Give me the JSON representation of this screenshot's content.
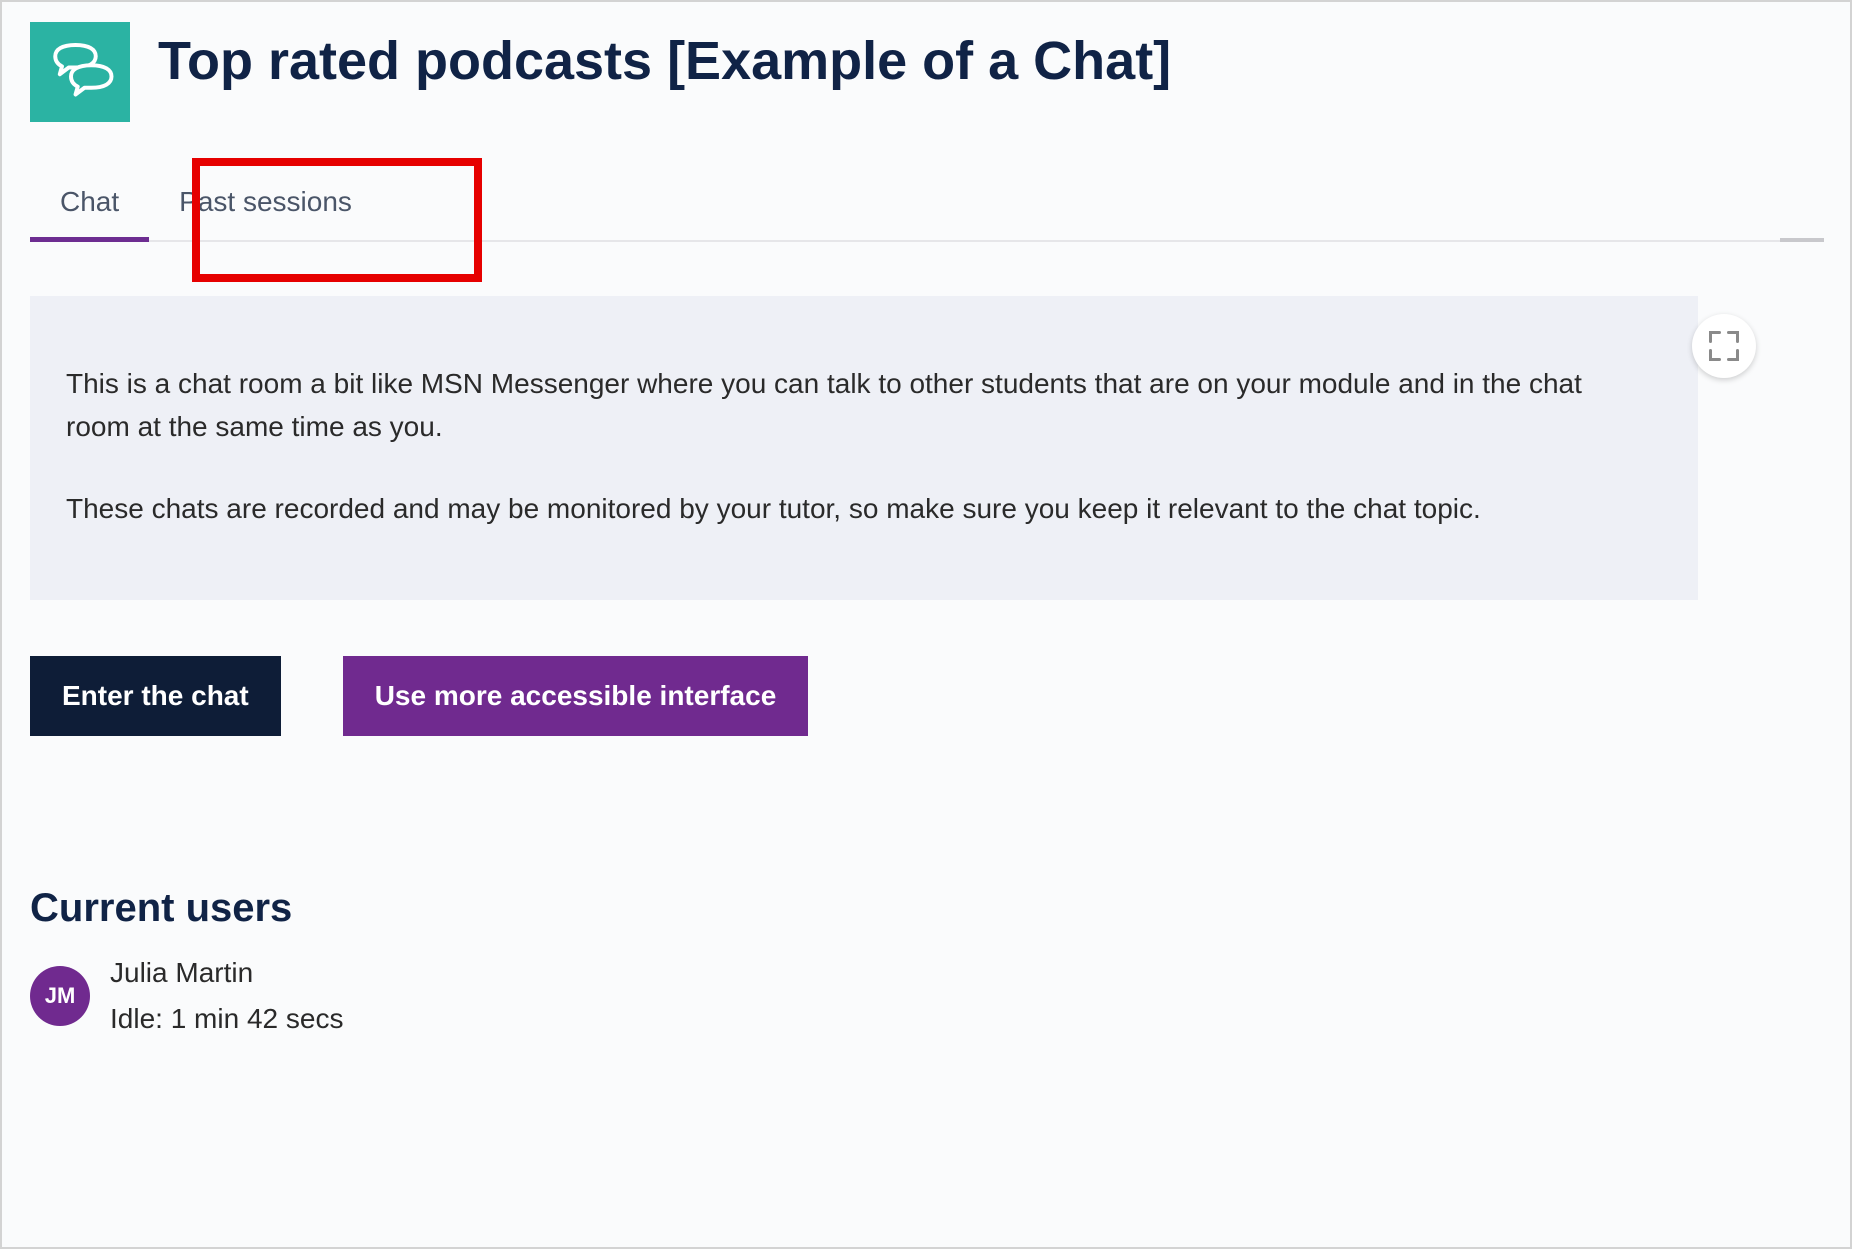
{
  "header": {
    "icon": "chat-bubbles-icon",
    "title": "Top rated podcasts [Example of a Chat]"
  },
  "tabs": [
    {
      "id": "chat",
      "label": "Chat",
      "active": true
    },
    {
      "id": "past-sessions",
      "label": "Past sessions",
      "active": false
    }
  ],
  "description": {
    "p1": "This is a chat room a bit like MSN Messenger where you can talk to other students that are on your module and in the chat room at the same time as you.",
    "p2": "These chats are recorded and may be monitored by your tutor, so make sure you keep it relevant to the chat topic.",
    "expand_icon": "expand-icon"
  },
  "buttons": {
    "enter_chat": "Enter the chat",
    "accessible": "Use more accessible interface"
  },
  "current_users": {
    "heading": "Current users",
    "users": [
      {
        "initials": "JM",
        "name": "Julia Martin",
        "idle": "Idle: 1 min 42 secs"
      }
    ]
  },
  "colors": {
    "brand_dark": "#0e1d37",
    "brand_purple": "#702a8f",
    "brand_teal": "#2bb3a3",
    "highlight_red": "#e60000"
  }
}
